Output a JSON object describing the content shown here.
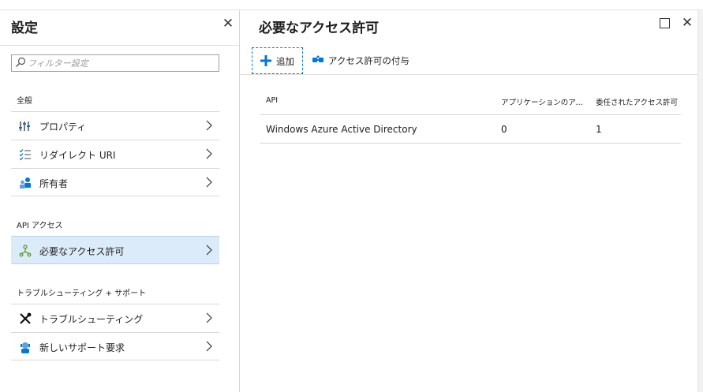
{
  "left_blade": {
    "title": "設定",
    "filter_placeholder": "フィルター設定",
    "sections": [
      {
        "title": "全般",
        "items": [
          {
            "label": "プロパティ",
            "icon": "properties-icon"
          },
          {
            "label": "リダイレクト URI",
            "icon": "list-icon"
          },
          {
            "label": "所有者",
            "icon": "owners-icon"
          }
        ]
      },
      {
        "title": "API アクセス",
        "items": [
          {
            "label": "必要なアクセス許可",
            "icon": "permissions-icon",
            "selected": true
          }
        ]
      },
      {
        "title": "トラブルシューティング + サポート",
        "items": [
          {
            "label": "トラブルシューティング",
            "icon": "tools-icon"
          },
          {
            "label": "新しいサポート要求",
            "icon": "support-icon"
          }
        ]
      }
    ]
  },
  "right_blade": {
    "title": "必要なアクセス許可",
    "toolbar": {
      "add_label": "追加",
      "grant_label": "アクセス許可の付与"
    },
    "table": {
      "columns": [
        "API",
        "アプリケーションのアクセス許可",
        "委任されたアクセス許可"
      ],
      "rows": [
        [
          "Windows Azure Active Directory",
          "0",
          "1"
        ]
      ]
    }
  },
  "colors": {
    "accent": "#0078d7",
    "selected_bg": "#dcebfa",
    "border": "#d8d8d8"
  }
}
